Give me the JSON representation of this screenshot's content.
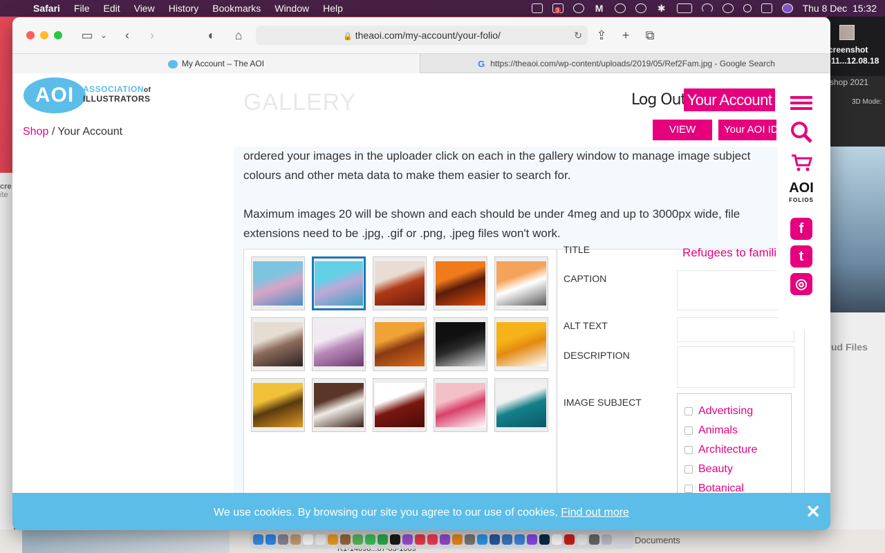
{
  "menubar": {
    "app": "Safari",
    "items": [
      "File",
      "Edit",
      "View",
      "History",
      "Bookmarks",
      "Window",
      "Help"
    ],
    "clock": "Thu 8 Dec  15:32",
    "badge": "3"
  },
  "desktop": {
    "right_filename_1": "creenshot",
    "right_filename_2": "-11...12.08.18",
    "ps_label": "shop 2021",
    "ps_mode": "3D Mode:",
    "ps_ruler_a": "0",
    "ps_ruler_b": "5000",
    "cloud_files": "ud Files",
    "left_a": "cre",
    "left_b": "ite",
    "documents": "Documents",
    "file_item": "R1-14098...07-03-1009"
  },
  "browser": {
    "url": "theaoi.com/my-account/your-folio/",
    "tabs": [
      {
        "label": "My Account – The AOI"
      },
      {
        "label": "https://theaoi.com/wp-content/uploads/2019/05/Ref2Fam.jpg - Google Search"
      }
    ]
  },
  "site": {
    "logo_mark": "AOI",
    "logo_line1": "ASSOCIATION",
    "logo_of": "of",
    "logo_line2": "ILLUSTRATORS",
    "breadcrumb_shop": "Shop",
    "breadcrumb_sep": " / ",
    "breadcrumb_current": "Your Account",
    "gallery_title": "GALLERY",
    "logout": "Log Out?",
    "your_account": "Your Account",
    "view_folio": "VIEW FOLIO",
    "aoi_id": "Your AOI ID: ",
    "folios_label_1": "AOI",
    "folios_label_2": "FOLIOS",
    "facebook": "f",
    "twitter": "t",
    "instagram": "◎"
  },
  "content": {
    "intro_1": "ordered your images in the uploader click on each in the gallery window to manage image subject colours and other meta data to make them easier to search for.",
    "intro_2": "Maximum images 20 will be shown and each should be under 4meg and up to 3000px wide, file extensions need to be .jpg, .gif or .png, .jpeg files won't work."
  },
  "form": {
    "title_label": "TITLE",
    "title_value": "Refugees to famili",
    "caption_label": "CAPTION",
    "alt_label": "ALT TEXT",
    "description_label": "DESCRIPTION",
    "subject_label": "IMAGE SUBJECT",
    "subjects": [
      "Advertising",
      "Animals",
      "Architecture",
      "Beauty",
      "Botanical"
    ]
  },
  "gallery": {
    "selected_index": 1,
    "images": [
      {
        "name": "refugees-family-beach",
        "colors": [
          "#7dc4e0",
          "#d9a5c8",
          "#4a8fc2"
        ]
      },
      {
        "name": "refugees-family-selected",
        "colors": [
          "#62d1e6",
          "#bfa8d8",
          "#3aa3c4"
        ]
      },
      {
        "name": "landscape-red-figure",
        "colors": [
          "#e9ddd3",
          "#b03a16",
          "#6a1c0c"
        ]
      },
      {
        "name": "orange-tree",
        "colors": [
          "#f07a1c",
          "#5a1c0c",
          "#e04e08"
        ]
      },
      {
        "name": "cat-dog-orange",
        "colors": [
          "#f4a35a",
          "#ffffff",
          "#5a5a5a"
        ]
      },
      {
        "name": "crow-fields",
        "colors": [
          "#e5ddd2",
          "#8c6b5b",
          "#2b2222"
        ]
      },
      {
        "name": "floral-purple",
        "colors": [
          "#f2eaf2",
          "#b88ab9",
          "#6c3a6e"
        ]
      },
      {
        "name": "orange-landscape",
        "colors": [
          "#f0a235",
          "#8a3a14",
          "#d96a1a"
        ]
      },
      {
        "name": "black-figures",
        "colors": [
          "#101010",
          "#2a2a2a",
          "#dcdcdc"
        ]
      },
      {
        "name": "yellow-book-cover",
        "colors": [
          "#f6b319",
          "#e38a10",
          "#ffffff"
        ]
      },
      {
        "name": "yellow-hills",
        "colors": [
          "#f2c13a",
          "#5a3a10",
          "#e09820"
        ]
      },
      {
        "name": "bulldog",
        "colors": [
          "#5a3628",
          "#f0ece6",
          "#3a2018"
        ]
      },
      {
        "name": "highland-cow",
        "colors": [
          "#ffffff",
          "#7a1810",
          "#4a0a08"
        ]
      },
      {
        "name": "pink-figure-sea",
        "colors": [
          "#f4c0c8",
          "#d8406a",
          "#ffffff"
        ]
      },
      {
        "name": "teal-wave",
        "colors": [
          "#f0f0f0",
          "#15808a",
          "#0a5a66"
        ]
      }
    ]
  },
  "cookie": {
    "text": "We use cookies. By browsing our site you agree to our use of cookies, ",
    "link": "Find out more",
    "close": "✕"
  }
}
